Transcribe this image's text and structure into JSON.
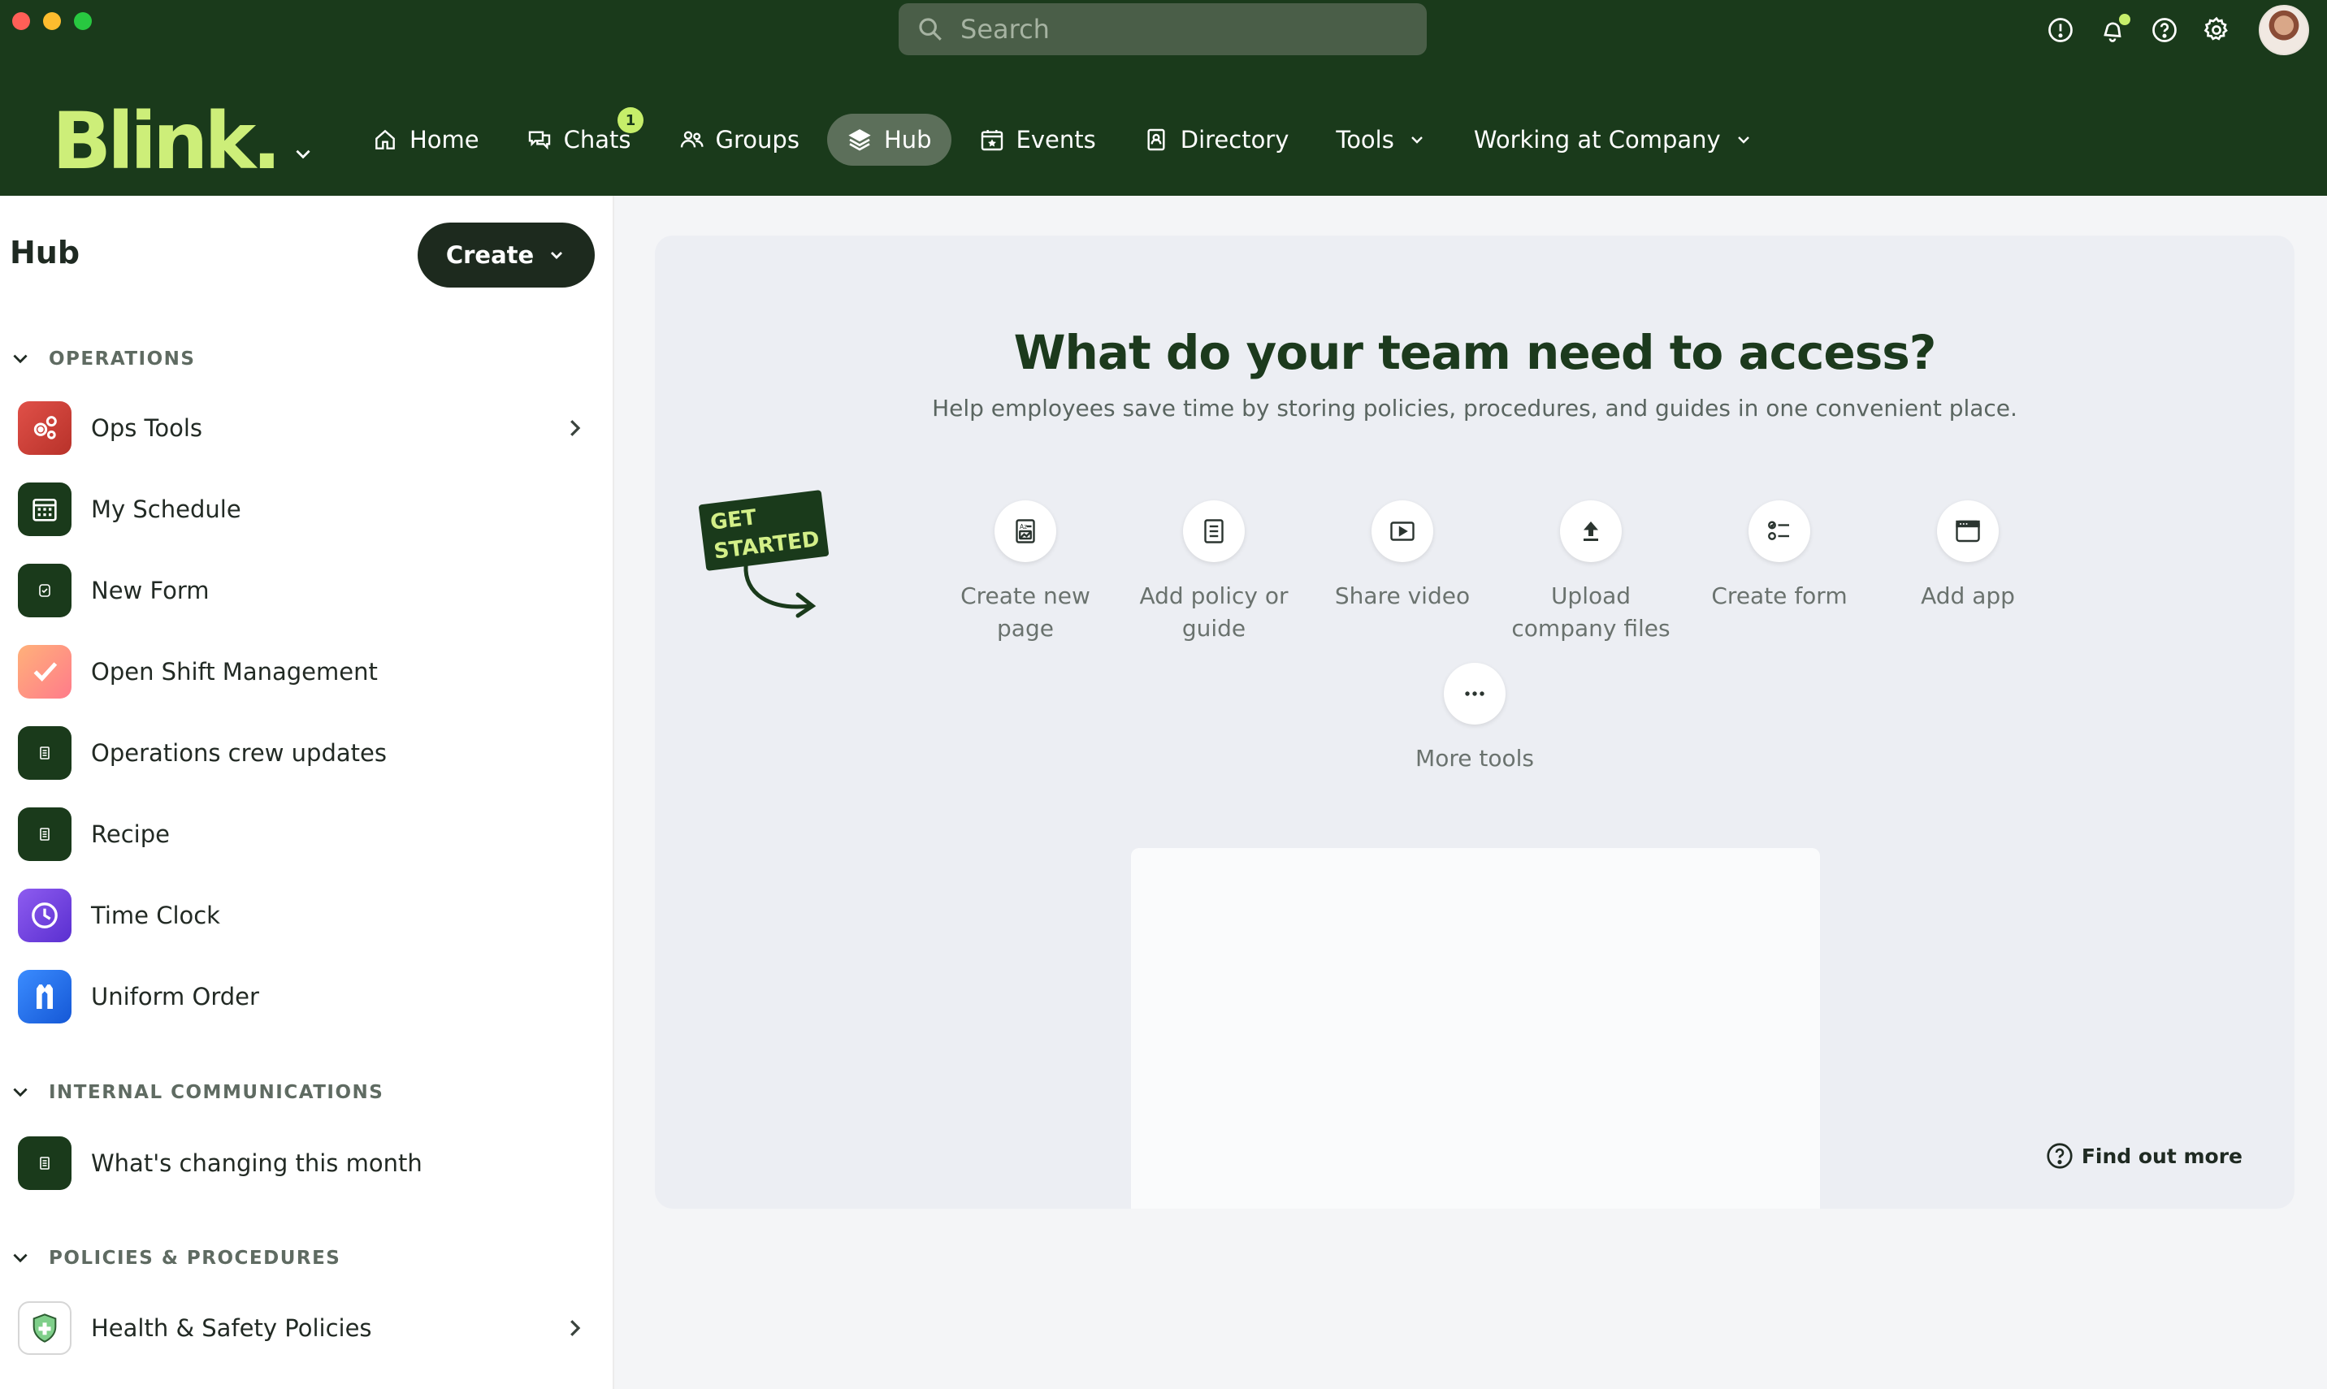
{
  "window": {
    "traffic_lights": [
      "close",
      "minimize",
      "maximize"
    ]
  },
  "search": {
    "placeholder": "Search"
  },
  "top_icons": [
    "alert-icon",
    "bell-icon",
    "help-icon",
    "settings-icon"
  ],
  "brand": {
    "logo": "Blink.",
    "accent": "#cdee79",
    "topbar_bg": "#1a3a1b"
  },
  "nav": {
    "items": [
      {
        "label": "Home",
        "icon": "home-icon"
      },
      {
        "label": "Chats",
        "icon": "chat-icon",
        "badge": "1"
      },
      {
        "label": "Groups",
        "icon": "groups-icon"
      },
      {
        "label": "Hub",
        "icon": "layers-icon",
        "active": true
      },
      {
        "label": "Events",
        "icon": "calendar-star-icon"
      },
      {
        "label": "Directory",
        "icon": "contact-book-icon"
      },
      {
        "label": "Tools",
        "icon": "chevron-down-icon"
      },
      {
        "label": "Working at Company",
        "icon": "chevron-down-icon"
      }
    ]
  },
  "sidebar": {
    "title": "Hub",
    "create_label": "Create",
    "sections": [
      {
        "title": "OPERATIONS",
        "items": [
          {
            "label": "Ops Tools",
            "icon": "gears-icon",
            "has_children": true
          },
          {
            "label": "My Schedule",
            "icon": "calendar-icon"
          },
          {
            "label": "New Form",
            "icon": "form-icon"
          },
          {
            "label": "Open Shift Management",
            "icon": "checkmark-icon"
          },
          {
            "label": "Operations crew updates",
            "icon": "document-icon"
          },
          {
            "label": "Recipe",
            "icon": "document-icon"
          },
          {
            "label": "Time Clock",
            "icon": "clock-icon"
          },
          {
            "label": "Uniform Order",
            "icon": "uniform-icon"
          }
        ]
      },
      {
        "title": "INTERNAL COMMUNICATIONS",
        "items": [
          {
            "label": "What's changing this month",
            "icon": "document-icon"
          }
        ]
      },
      {
        "title": "POLICIES & PROCEDURES",
        "items": [
          {
            "label": "Health & Safety Policies",
            "icon": "shield-icon",
            "has_children": true
          }
        ]
      }
    ]
  },
  "main": {
    "headline": "What do your team need to access?",
    "subline": "Help employees save time by storing policies, procedures, and guides in one convenient place.",
    "sticker": {
      "line1": "GET",
      "line2": "STARTED"
    },
    "tools": [
      {
        "label": "Create new page",
        "icon": "page-icon"
      },
      {
        "label": "Add policy or guide",
        "icon": "document-icon"
      },
      {
        "label": "Share video",
        "icon": "video-icon"
      },
      {
        "label": "Upload company files",
        "icon": "upload-icon"
      },
      {
        "label": "Create form",
        "icon": "form-checklist-icon"
      },
      {
        "label": "Add app",
        "icon": "app-window-icon"
      }
    ],
    "more_tools": {
      "label": "More tools",
      "icon": "ellipsis-icon"
    },
    "find_out_more": "Find out more"
  }
}
